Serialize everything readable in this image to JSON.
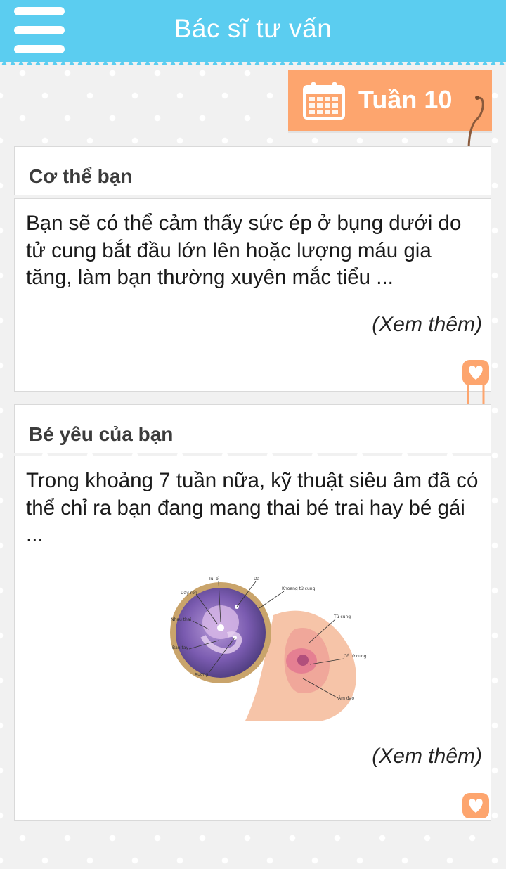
{
  "header": {
    "title": "Bác sĩ tư vấn",
    "menu_icon": "hamburger-menu-icon"
  },
  "week": {
    "label": "Tuần 10",
    "icon": "calendar-icon"
  },
  "sections": [
    {
      "title": "Cơ thể bạn",
      "text": "Bạn sẽ có thể cảm thấy sức ép ở bụng dưới do tử cung bắt đầu lớn lên hoặc lượng máu gia tăng, làm bạn thường xuyên mắc tiểu ...",
      "more": "(Xem thêm)"
    },
    {
      "title": "Bé yêu của bạn",
      "text": "Trong khoảng 7 tuần nữa, kỹ thuật siêu âm đã có thể chỉ ra bạn đang mang thai bé trai hay bé gái ...",
      "more": "(Xem thêm)",
      "illustration_labels": {
        "tui_oi": "Túi ối",
        "da": "Da",
        "day_ron": "Dây rốn",
        "khoang_tu_cung": "Khoang tử cung",
        "nhau_thai": "Nhau thai",
        "ban_tay": "Bàn tay",
        "xuong": "Xương",
        "tu_cung": "Tử cung",
        "co_tu_cung": "Cổ tử cung",
        "am_dao": "Âm đạo"
      }
    }
  ],
  "colors": {
    "header": "#5bcdf0",
    "badge": "#fda56e",
    "background": "#f1f1f1"
  }
}
